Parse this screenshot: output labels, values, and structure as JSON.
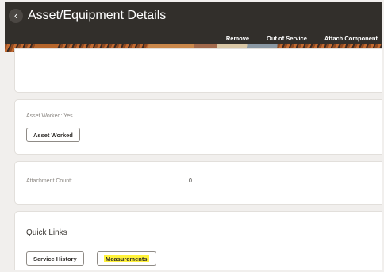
{
  "header": {
    "back_icon": "‹",
    "title": "Asset/Equipment Details",
    "actions": [
      "Remove",
      "Out of Service",
      "Attach Component"
    ]
  },
  "asset_worked": {
    "label": "Asset Worked: Yes",
    "button": "Asset Worked"
  },
  "attachment": {
    "label": "Attachment Count:",
    "value": "0"
  },
  "quick_links": {
    "title": "Quick Links",
    "service_history": "Service History",
    "measurements": "Measurements",
    "highlight_color": "#fff23a"
  }
}
